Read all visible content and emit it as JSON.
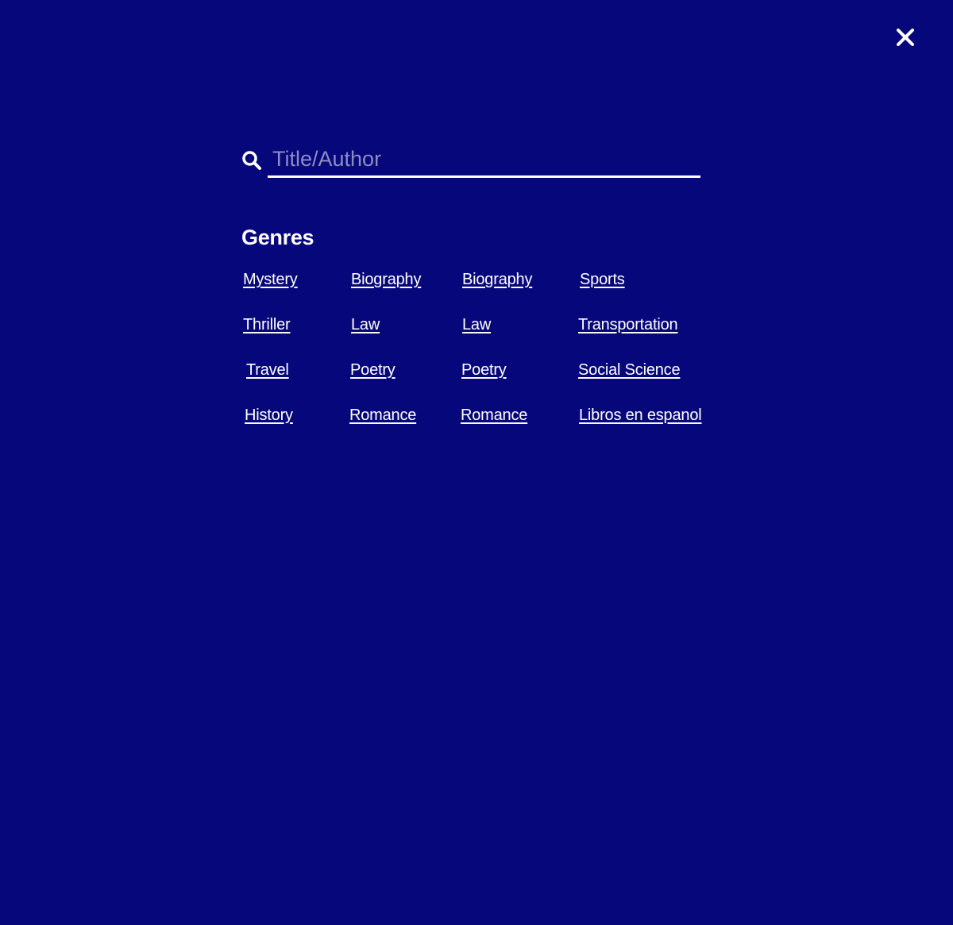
{
  "overlay": {
    "background_color": "#07077c",
    "close_icon": "close-icon"
  },
  "search": {
    "placeholder": "Title/Author",
    "value": "",
    "icon": "search-icon"
  },
  "genres": {
    "title": "Genres",
    "columns": [
      [
        "Mystery",
        "Thriller",
        "Travel",
        "History"
      ],
      [
        "Biography",
        "Law",
        "Poetry",
        "Romance"
      ],
      [
        "Biography",
        "Law",
        "Poetry",
        "Romance"
      ],
      [
        "Sports",
        "Transportation",
        "Social Science",
        "Libros en espanol"
      ]
    ]
  }
}
